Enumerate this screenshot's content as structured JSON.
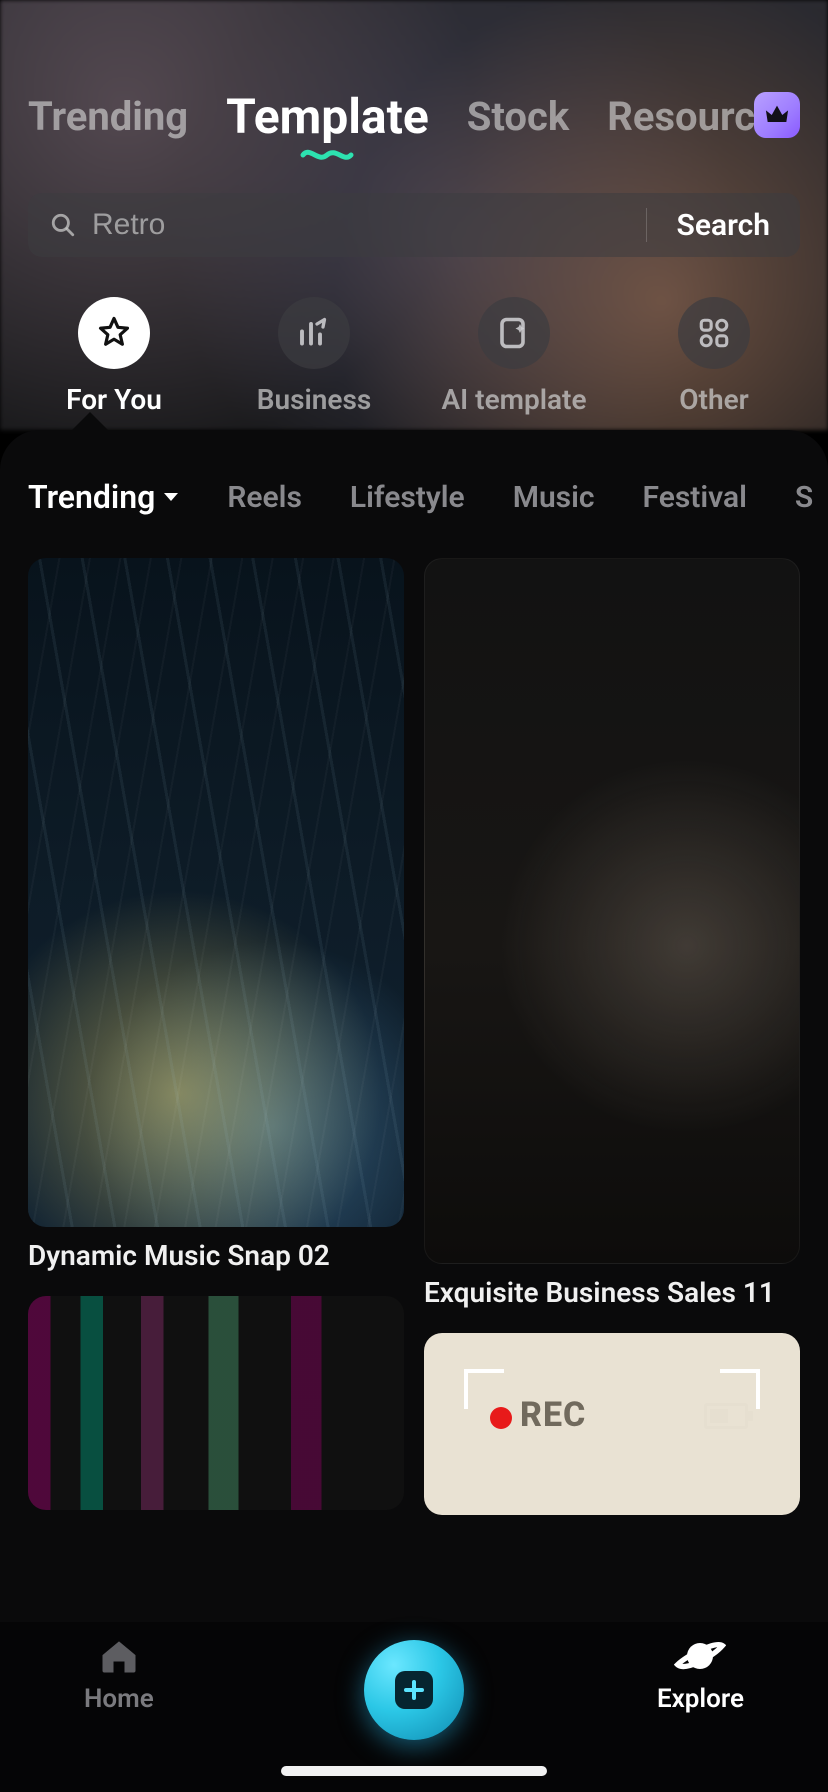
{
  "top_nav": {
    "items": [
      {
        "label": "Trending"
      },
      {
        "label": "Template"
      },
      {
        "label": "Stock"
      },
      {
        "label": "Resource"
      }
    ]
  },
  "search": {
    "placeholder": "Retro",
    "button": "Search"
  },
  "categories": {
    "items": [
      {
        "label": "For You"
      },
      {
        "label": "Business"
      },
      {
        "label": "AI template"
      },
      {
        "label": "Other"
      }
    ]
  },
  "filters": {
    "items": [
      {
        "label": "Trending"
      },
      {
        "label": "Reels"
      },
      {
        "label": "Lifestyle"
      },
      {
        "label": "Music"
      },
      {
        "label": "Festival"
      },
      {
        "label": "S"
      }
    ]
  },
  "cards": {
    "items": [
      {
        "title": "Dynamic Music Snap 02"
      },
      {
        "title": "Exquisite Business Sales 11"
      }
    ]
  },
  "rec": {
    "label": "REC"
  },
  "bottom": {
    "home": "Home",
    "explore": "Explore"
  }
}
